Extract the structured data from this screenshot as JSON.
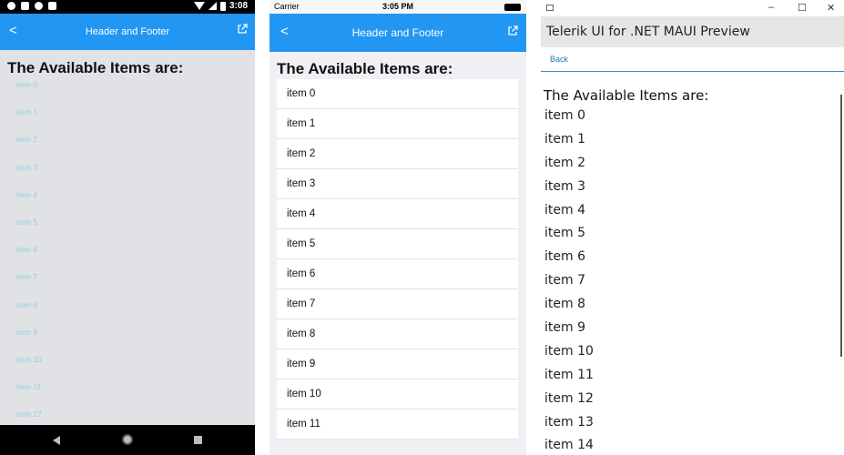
{
  "android": {
    "status_time": "3:08",
    "toolbar_title": "Header and Footer",
    "back_glyph": "<",
    "header": "The Available Items are:",
    "items": [
      "item 0",
      "item 1",
      "item 2",
      "item 3",
      "item 4",
      "item 5",
      "item 6",
      "item 7",
      "item 8",
      "item 9",
      "item 10",
      "item 11",
      "item 12"
    ]
  },
  "ios": {
    "carrier": "Carrier",
    "status_time": "3:05 PM",
    "nav_title": "Header and Footer",
    "back_glyph": "<",
    "header": "The Available Items are:",
    "items": [
      "item 0",
      "item 1",
      "item 2",
      "item 3",
      "item 4",
      "item 5",
      "item 6",
      "item 7",
      "item 8",
      "item 9",
      "item 10",
      "item 11"
    ]
  },
  "windows": {
    "app_title": "Telerik UI for .NET MAUI Preview",
    "minimize_glyph": "–",
    "maximize_glyph": "☐",
    "close_glyph": "✕",
    "back_label": "Back",
    "header": "The Available Items are:",
    "items": [
      "item 0",
      "item 1",
      "item 2",
      "item 3",
      "item 4",
      "item 5",
      "item 6",
      "item 7",
      "item 8",
      "item 9",
      "item 10",
      "item 11",
      "item 12",
      "item 13",
      "item 14"
    ]
  },
  "colors": {
    "accent": "#2196f3",
    "android_item_text": "#8ed1e3",
    "android_bg": "#e1e2e5",
    "ios_bg": "#efeff4",
    "win_link": "#1779ba"
  }
}
